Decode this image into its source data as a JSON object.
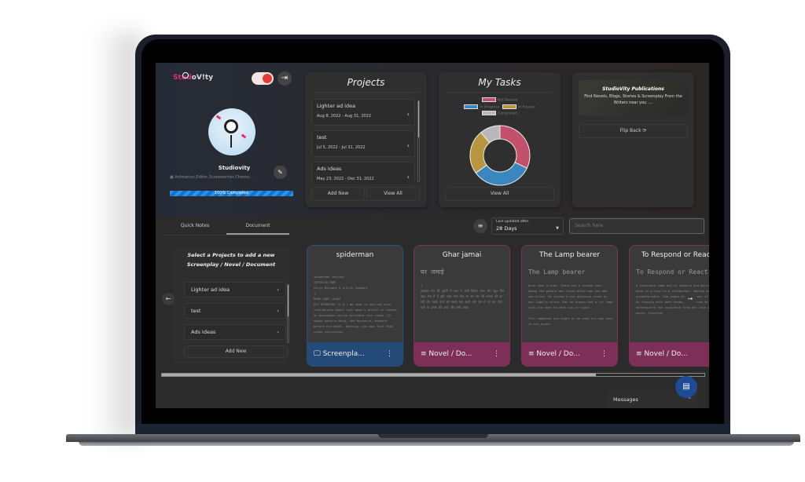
{
  "app": {
    "logo_prefix": "Stud",
    "logo_suffix": "oV!ty",
    "theme_toggle_on": true
  },
  "profile": {
    "name": "Studiovity",
    "roles": "Animation,Editor,Screenwriter,Choreo...",
    "progress_label": "100% Completed",
    "progress_percent": 100
  },
  "projects": {
    "title": "Projects",
    "items": [
      {
        "name": "Lighter ad idea",
        "dates": "Aug 8, 2022 - Aug 31, 2022"
      },
      {
        "name": "test",
        "dates": "Jul 5, 2022 - Jul 31, 2022"
      },
      {
        "name": "Ads Ideas",
        "dates": "May 23, 2022 - Dec 31, 2022"
      }
    ],
    "add_new": "Add New",
    "view_all": "View All"
  },
  "tasks": {
    "title": "My Tasks",
    "view_all": "View All"
  },
  "chart_data": {
    "type": "pie",
    "title": "My Tasks",
    "legend": [
      "Not Started",
      "In Progress",
      "In Review",
      "Completed"
    ],
    "legend_position": "top",
    "series": [
      {
        "name": "Not Started",
        "value": 32,
        "color": "#c2506a"
      },
      {
        "name": "In Progress",
        "value": 33,
        "color": "#3a87c0"
      },
      {
        "name": "In Review",
        "value": 24,
        "color": "#b89640"
      },
      {
        "name": "Completed",
        "value": 11,
        "color": "#b8b8b8"
      }
    ]
  },
  "publications": {
    "title": "StudioVity Publications",
    "subtitle": "Find Novels, Blogs, Stories & Screenplay From the Writers near you ....",
    "flip_back": "Flip Back"
  },
  "tabs": [
    {
      "label": "Quick Notes",
      "active": false
    },
    {
      "label": "Document",
      "active": true
    }
  ],
  "filters": {
    "last_updated_label": "Last updated after",
    "last_updated_value": "28 Days",
    "search_placeholder": "Search here"
  },
  "select_panel": {
    "heading_line1": "Select a Projects to add a new",
    "heading_line2": "Screenplay / Novel / Document",
    "items": [
      "Lighter ad idea",
      "test",
      "Ads Ideas"
    ],
    "add_new": "Add New"
  },
  "documents": [
    {
      "title": "spiderman",
      "type": "Screenpla...",
      "kind": "screenplay",
      "big": "",
      "text": "spiderman Section\nINTERIOR ROM\nChris McEvans & A Erik Summers\n1.\nDUBS SOBY LOGOS\nB7I REPORTER (V.O.) We come to you now with revelations about last week's attack in London. An anonymous source provided this video. It shows Quentin Beck, aka Mysterio, moments before his death. Warning: you may find this video disturbing."
    },
    {
      "title": "Ghar jamai",
      "type": "Novel / Do...",
      "kind": "novel",
      "big": "घर जमाई",
      "text": "1\nइस्तमान मेंटा की दुर्वानी में उतत में जानी किशन जाता और बहुत फिर बढ़ा। सब में ये पूर्वी उतरा गरम मेंटा पर उन जन की मानता की आ नही थी। उसके दोनों घरे उसके चाह आदी और उस में जो रहा दोनों बारी के उसके की आर्य और उसी उसके"
    },
    {
      "title": "The Lamp bearer",
      "type": "Novel / Do...",
      "kind": "novel",
      "big": "The Lamp bearer",
      "text": "Once upon a time, there was a sleepy town. Among the people who lived alone was one who was blind. He couldn't see anything since he was legally blind. But he always had a lit lamp with him when he went out at night.\n\nThis happened one night as he made his way back to his house"
    },
    {
      "title": "To Respond or React",
      "type": "Novel / Do...",
      "kind": "novel",
      "big": "To Respond or React",
      "text": "A cockroach came out of nowhere and perched down on a lady in a restaurant, making her feel uncomfortable. She began to shout out of panic. By leaping with both hands, she tried to exterminate the cockroach from her face in a panic. Everyone"
    }
  ],
  "scroll": {
    "horizontal_position_percent": 80
  },
  "messages": {
    "label": "Messages"
  }
}
